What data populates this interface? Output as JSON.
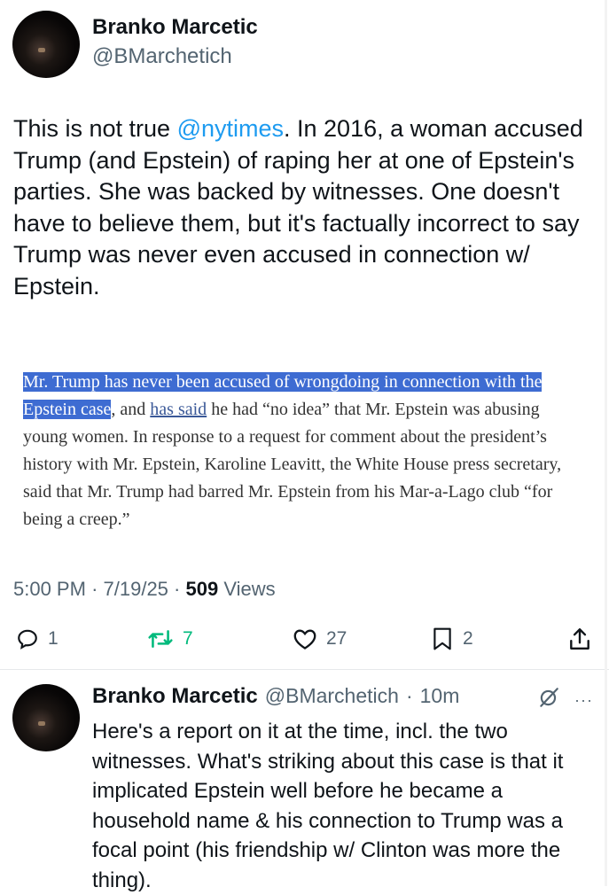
{
  "tweet": {
    "author_name": "Branko Marcetic",
    "author_handle": "@BMarchetich",
    "text_before_mention": "This is not true ",
    "mention": "@nytimes",
    "text_after_mention": ". In 2016, a woman accused Trump (and Epstein) of raping her at one of Epstein's parties. She was backed by witnesses. One doesn't have to believe them, but it's factually incorrect to say Trump was never even accused in connection w/ Epstein.",
    "clipping": {
      "highlighted": "Mr. Trump has never been accused of wrongdoing in connection with the Epstein case",
      "after_highlight": ", and ",
      "link_text": "has said",
      "rest": " he had “no idea” that Mr. Epstein was abusing young women. In response to a request for comment about the president’s history with Mr. Epstein, Karoline Leavitt, the White House press secretary, said that Mr. Trump had barred Mr. Epstein from his Mar-a-Lago club “for being a creep.”"
    },
    "time": "5:00 PM",
    "separator": "·",
    "date": "7/19/25",
    "views_count": "509",
    "views_label": "Views",
    "stats": {
      "replies": "1",
      "reposts": "7",
      "likes": "27",
      "bookmarks": "2"
    }
  },
  "reply": {
    "author_name": "Branko Marcetic",
    "author_handle": "@BMarchetich",
    "separator": "·",
    "time_ago": "10m",
    "more_label": "···",
    "text": "Here's a report on it at the time, incl. the two witnesses. What's striking about this case is that it implicated Epstein well before he became a household name & his connection to Trump was a focal point (his friendship w/ Clinton was more the thing)."
  },
  "icons": [
    "reply-icon",
    "repost-icon",
    "like-icon",
    "bookmark-icon",
    "share-icon",
    "grok-icon"
  ],
  "colors": {
    "text": "#0f1419",
    "secondary": "#536471",
    "mention": "#1d9bf0",
    "repost": "#00ba7c",
    "highlight": "#3e6cd2"
  }
}
